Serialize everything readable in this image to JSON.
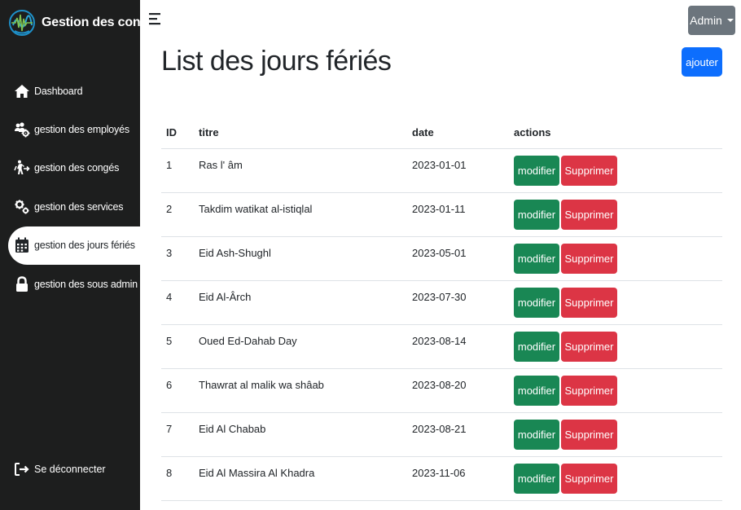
{
  "app": {
    "title": "Gestion des congés",
    "logo_icon": "brain-wave-logo"
  },
  "sidebar": {
    "items": [
      {
        "label": "Dashboard",
        "icon": "home-icon"
      },
      {
        "label": "gestion des employés",
        "icon": "users-gear-icon"
      },
      {
        "label": "gestion des congés",
        "icon": "person-walking-arrow-icon"
      },
      {
        "label": "gestion des services",
        "icon": "gears-icon"
      },
      {
        "label": "gestion des jours fériés",
        "icon": "calendar-icon",
        "active": true
      },
      {
        "label": "gestion des sous admin",
        "icon": "lock-icon"
      }
    ],
    "logout": {
      "label": "Se déconnecter",
      "icon": "logout-icon"
    }
  },
  "header": {
    "menu_icon": "hamburger-icon",
    "user_menu_label": "Admin"
  },
  "main": {
    "title": "List des jours fériés",
    "add_label": "ajouter",
    "table": {
      "columns": [
        "ID",
        "titre",
        "date",
        "actions"
      ],
      "rows": [
        {
          "id": "1",
          "titre": "Ras l' âm",
          "date": "2023-01-01"
        },
        {
          "id": "2",
          "titre": "Takdim watikat al-istiqlal",
          "date": "2023-01-11"
        },
        {
          "id": "3",
          "titre": "Eid Ash-Shughl",
          "date": "2023-05-01"
        },
        {
          "id": "4",
          "titre": "Eid Al-Ârch",
          "date": "2023-07-30"
        },
        {
          "id": "5",
          "titre": "Oued Ed-Dahab Day",
          "date": "2023-08-14"
        },
        {
          "id": "6",
          "titre": "Thawrat al malik wa shâab",
          "date": "2023-08-20"
        },
        {
          "id": "7",
          "titre": "Eid Al Chabab",
          "date": "2023-08-21"
        },
        {
          "id": "8",
          "titre": "Eid Al Massira Al Khadra",
          "date": "2023-11-06"
        }
      ],
      "edit_label": "modifier",
      "delete_label": "Supprimer"
    }
  },
  "colors": {
    "sidebar_bg": "#1d1e1e",
    "primary": "#0d6efd",
    "success": "#198754",
    "danger": "#dc3545",
    "secondary": "#6c757d"
  }
}
